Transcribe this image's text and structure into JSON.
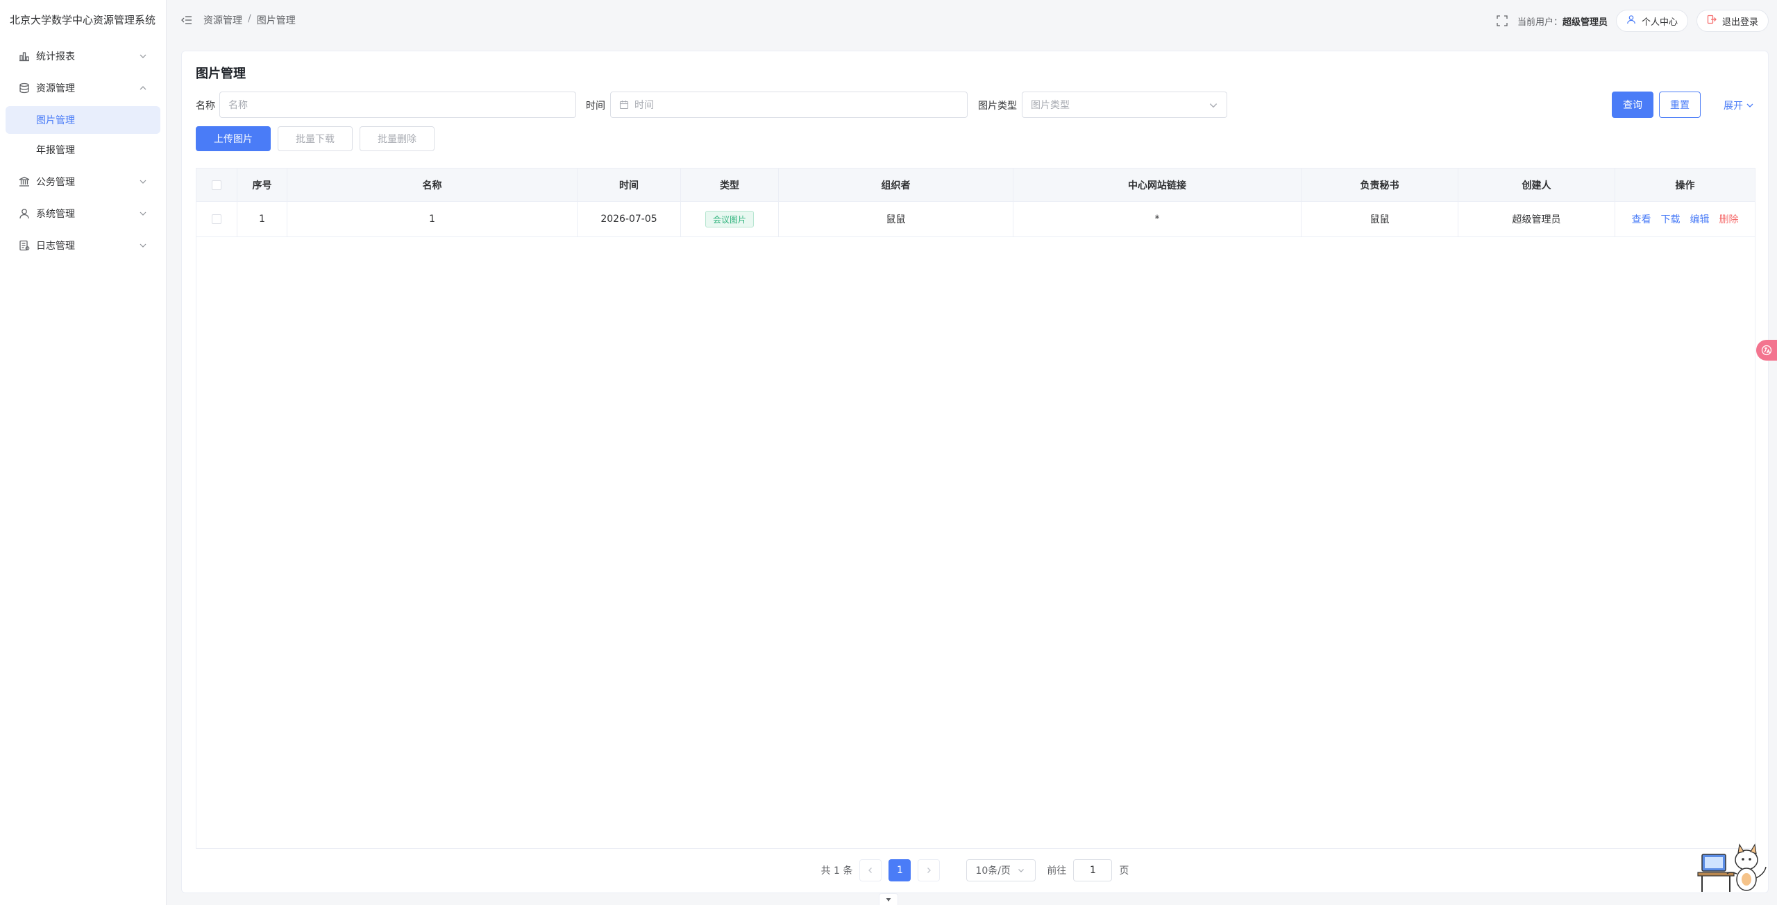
{
  "app": {
    "title": "北京大学数学中心资源管理系统"
  },
  "sidebar": {
    "items": [
      {
        "label": "统计报表",
        "icon": "bar-chart-icon"
      },
      {
        "label": "资源管理",
        "icon": "database-icon",
        "expanded": true,
        "children": [
          {
            "label": "图片管理",
            "active": true
          },
          {
            "label": "年报管理"
          }
        ]
      },
      {
        "label": "公务管理",
        "icon": "bank-icon"
      },
      {
        "label": "系统管理",
        "icon": "user-icon"
      },
      {
        "label": "日志管理",
        "icon": "log-icon"
      }
    ]
  },
  "header": {
    "breadcrumb": [
      "资源管理",
      "图片管理"
    ],
    "breadcrumb_sep": "/",
    "current_user_label": "当前用户：",
    "current_user": "超级管理员",
    "profile_label": "个人中心",
    "logout_label": "退出登录"
  },
  "page": {
    "title": "图片管理"
  },
  "filters": {
    "name_label": "名称",
    "name_placeholder": "名称",
    "time_label": "时间",
    "time_placeholder": "时间",
    "type_label": "图片类型",
    "type_placeholder": "图片类型",
    "query_label": "查询",
    "reset_label": "重置",
    "expand_label": "展开"
  },
  "actions": {
    "upload_label": "上传图片",
    "batch_download_label": "批量下载",
    "batch_delete_label": "批量删除"
  },
  "table": {
    "columns": [
      "序号",
      "名称",
      "时间",
      "类型",
      "组织者",
      "中心网站链接",
      "负责秘书",
      "创建人",
      "操作"
    ],
    "rows": [
      {
        "index": "1",
        "name": "1",
        "time": "2026-07-05",
        "type": "会议图片",
        "organizer": "鼠鼠",
        "link": "*",
        "secretary": "鼠鼠",
        "creator": "超级管理员"
      }
    ],
    "row_actions": [
      "查看",
      "下载",
      "编辑",
      "删除"
    ]
  },
  "pagination": {
    "total_text": "共 1 条",
    "current_page": "1",
    "page_size": "10条/页",
    "goto_label": "前往",
    "goto_value": "1",
    "page_suffix": "页"
  },
  "colors": {
    "primary": "#4a7cf7",
    "danger": "#f56c6c",
    "success": "#32b47e"
  }
}
